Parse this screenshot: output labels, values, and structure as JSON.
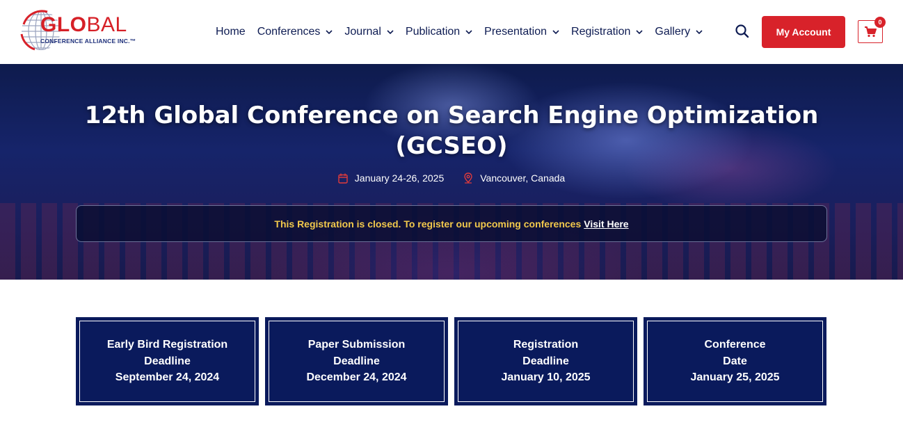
{
  "logo": {
    "title_part1": "GLO",
    "title_part2": "BAL",
    "subtitle": "CONFERENCE ALLIANCE INC.™"
  },
  "nav": {
    "items": [
      {
        "label": "Home",
        "has_dropdown": false
      },
      {
        "label": "Conferences",
        "has_dropdown": true
      },
      {
        "label": "Journal",
        "has_dropdown": true
      },
      {
        "label": "Publication",
        "has_dropdown": true
      },
      {
        "label": "Presentation",
        "has_dropdown": true
      },
      {
        "label": "Registration",
        "has_dropdown": true
      },
      {
        "label": "Gallery",
        "has_dropdown": true
      }
    ],
    "search_icon": "search-icon",
    "account_label": "My Account",
    "cart_count": "0"
  },
  "hero": {
    "title": "12th Global Conference on Search Engine Optimization (GCSEO)",
    "date": "January 24-26, 2025",
    "location": "Vancouver, Canada",
    "notice": "This Registration is closed. To register our upcoming conferences",
    "notice_link": "Visit Here"
  },
  "deadlines": [
    {
      "line1": "Early Bird Registration",
      "line2": "Deadline",
      "date": "September 24, 2024"
    },
    {
      "line1": "Paper Submission",
      "line2": "Deadline",
      "date": "December 24, 2024"
    },
    {
      "line1": "Registration",
      "line2": "Deadline",
      "date": "January 10, 2025"
    },
    {
      "line1": "Conference",
      "line2": "Date",
      "date": "January 25, 2025"
    }
  ],
  "colors": {
    "brand_red": "#d8222a",
    "navy": "#0a1a5c",
    "notice_yellow": "#f2c94c"
  }
}
